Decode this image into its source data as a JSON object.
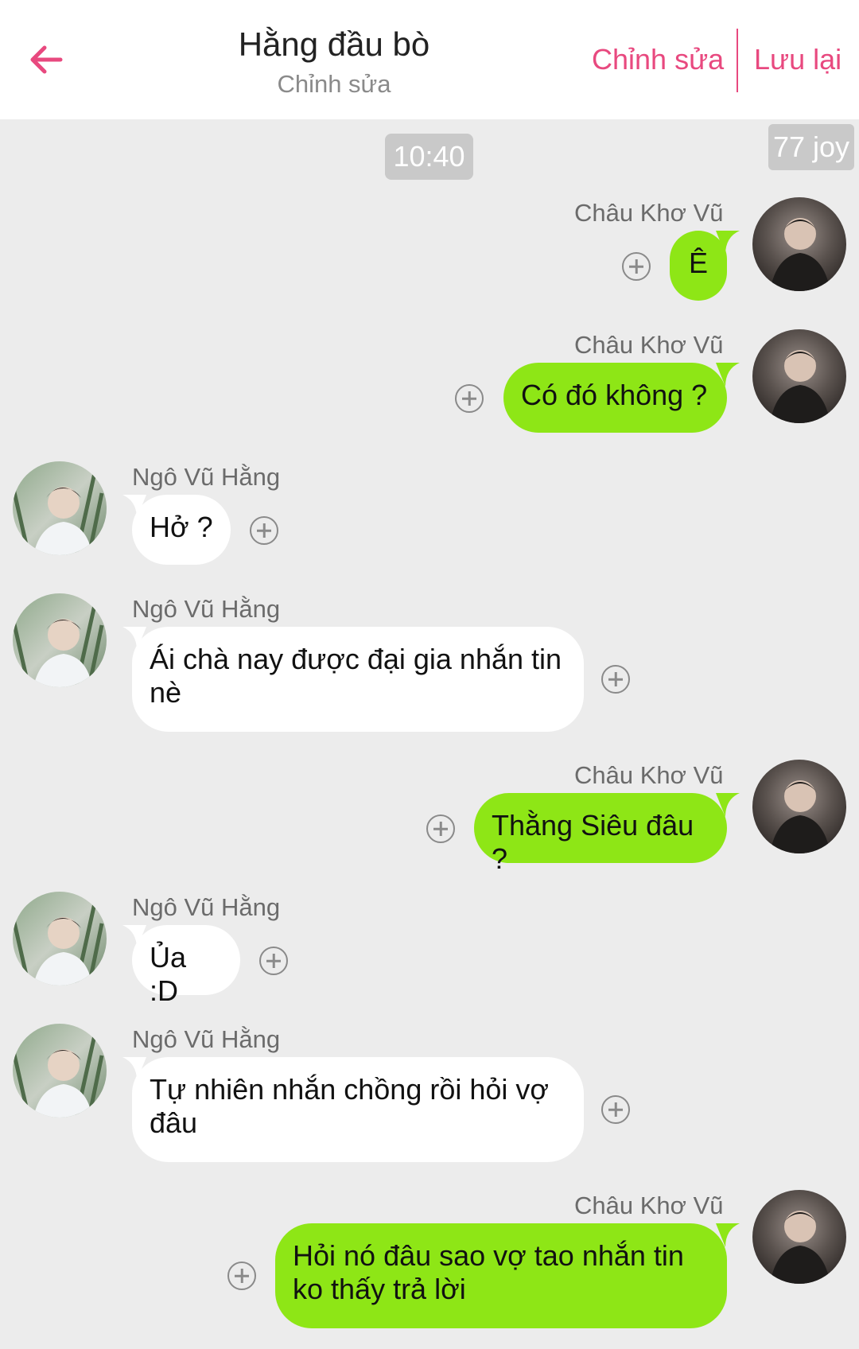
{
  "header": {
    "title": "Hằng đầu bò",
    "subtitle": "Chỉnh sửa",
    "edit_label": "Chỉnh sửa",
    "save_label": "Lưu lại",
    "accent_color": "#e8497f"
  },
  "time_label": "10:40",
  "badge_label": "77 joy",
  "colors": {
    "outgoing_bubble": "#8ee616",
    "incoming_bubble": "#ffffff",
    "background": "#ececec"
  },
  "messages": [
    {
      "sender": "Châu Khơ Vũ",
      "direction": "out",
      "text": "Ê"
    },
    {
      "sender": "Châu Khơ Vũ",
      "direction": "out",
      "text": "Có đó không ?"
    },
    {
      "sender": "Ngô Vũ Hằng",
      "direction": "in",
      "text": "Hở ?"
    },
    {
      "sender": "Ngô Vũ Hằng",
      "direction": "in",
      "text": "Ái chà nay được đại gia nhắn tin nè"
    },
    {
      "sender": "Châu Khơ Vũ",
      "direction": "out",
      "text": "Thằng Siêu đâu ?"
    },
    {
      "sender": "Ngô Vũ Hằng",
      "direction": "in",
      "text": "Ủa :D"
    },
    {
      "sender": "Ngô Vũ Hằng",
      "direction": "in",
      "text": "Tự nhiên nhắn chồng rồi hỏi vợ đâu"
    },
    {
      "sender": "Châu Khơ Vũ",
      "direction": "out",
      "text": "Hỏi nó đâu sao vợ tao nhắn tin ko thấy trả lời"
    }
  ],
  "icons": {
    "back": "arrow-left-icon",
    "add": "plus-circle-icon"
  }
}
